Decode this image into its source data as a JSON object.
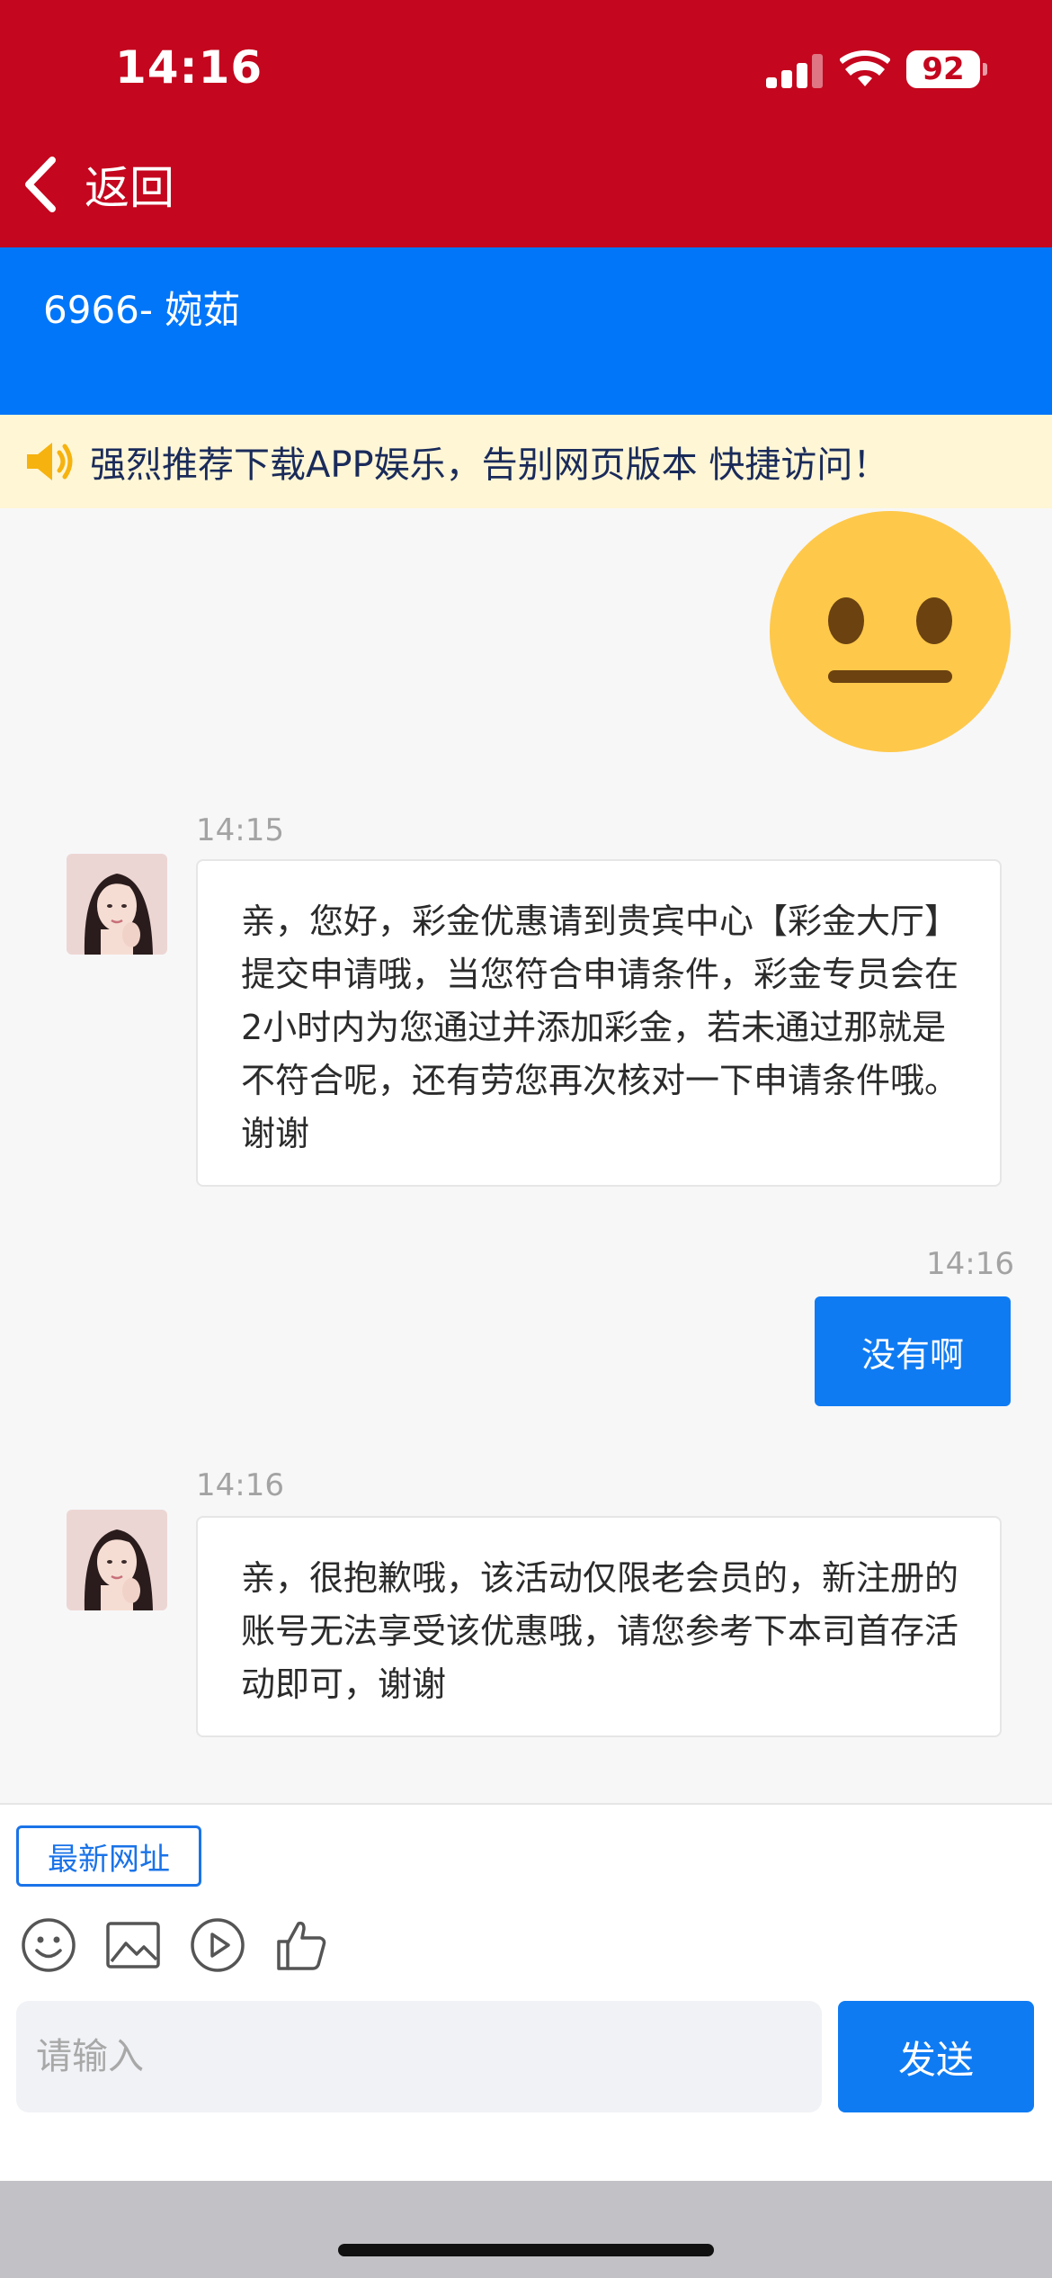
{
  "status_bar": {
    "time": "14:16",
    "battery": "92"
  },
  "nav": {
    "back_label": "返回"
  },
  "header": {
    "title": "6966- 婉茹"
  },
  "notice": {
    "text": "强烈推荐下载APP娱乐，告别网页版本 快捷访问！"
  },
  "messages": [
    {
      "direction": "out",
      "type": "emoji",
      "content": "neutral-face-emoji"
    },
    {
      "direction": "in",
      "time": "14:15",
      "text": "亲，您好，彩金优惠请到贵宾中心【彩金大厅】提交申请哦，当您符合申请条件，彩金专员会在2小时内为您通过并添加彩金，若未通过那就是不符合呢，还有劳您再次核对一下申请条件哦。谢谢"
    },
    {
      "direction": "out",
      "time": "14:16",
      "text": "没有啊"
    },
    {
      "direction": "in",
      "time": "14:16",
      "text": "亲，很抱歉哦，该活动仅限老会员的，新注册的账号无法享受该优惠哦，请您参考下本司首存活动即可，谢谢"
    }
  ],
  "input_bar": {
    "latest_url_label": "最新网址",
    "tools": [
      "smiley-icon",
      "image-icon",
      "play-icon",
      "thumbs-up-icon"
    ],
    "placeholder": "请输入",
    "send_label": "发送"
  },
  "colors": {
    "top_bar": "#c4061e",
    "title_band": "#0276f9",
    "accent": "#0f7bf3",
    "notice_bg": "#fef6d5"
  }
}
